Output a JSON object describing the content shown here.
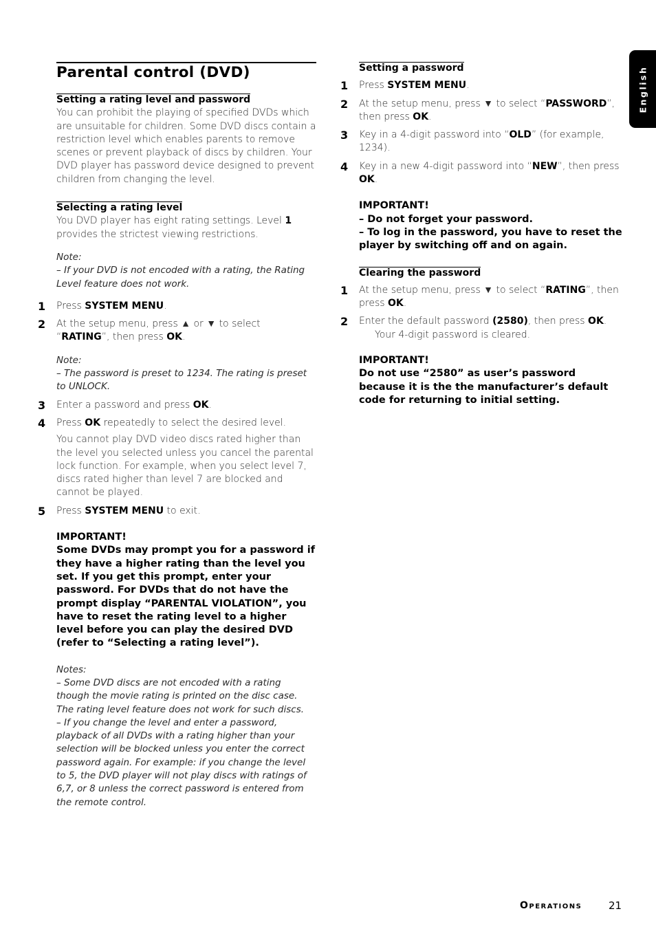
{
  "side_tab": {
    "label": "English"
  },
  "left": {
    "title": "Parental control (DVD)",
    "sec1": {
      "heading": "Setting a rating level and password",
      "body": "You can prohibit the playing of specified DVDs which are unsuitable for children. Some DVD discs contain a restriction level which enables parents to remove scenes or prevent playback of discs by children. Your DVD player has password device designed to prevent children from changing the level."
    },
    "sec2": {
      "heading": "Selecting a rating level",
      "body_pre": "You DVD player has eight rating settings. Level ",
      "body_bold": "1",
      "body_post": " provides the strictest viewing restrictions.",
      "note1_label": "Note:",
      "note1_text": "–  If your DVD is not encoded with a rating, the Rating Level feature does not work.",
      "steps": [
        {
          "num": "1",
          "pre": "Press ",
          "bold": "SYSTEM MENU",
          "post": "."
        },
        {
          "num": "2",
          "pre": "At the setup menu, press ▲ or ▼ to select “",
          "bold": "RATING",
          "post": "”, then press ",
          "bold2": "OK",
          "post2": "."
        }
      ],
      "note2_label": "Note:",
      "note2_text": "–  The password is preset to 1234. The rating is preset to UNLOCK.",
      "steps2": [
        {
          "num": "3",
          "pre": "Enter a password and press ",
          "bold": "OK",
          "post": "."
        },
        {
          "num": "4",
          "pre": "Press ",
          "bold": "OK",
          "post": " repeatedly to select the desired level."
        }
      ],
      "step4_detail": "You cannot play DVD video discs rated higher than the level you selected unless you cancel the parental lock function. For example, when you select level 7, discs rated higher than level 7 are blocked and cannot be played.",
      "step5": {
        "num": "5",
        "pre": "Press ",
        "bold": "SYSTEM MENU",
        "post": " to exit."
      },
      "important_label": "IMPORTANT!",
      "important_text": "Some DVDs may prompt you for a password if they have a higher rating than the level you set. If you get this prompt, enter your password.  For DVDs that do not have the prompt display “PARENTAL VIOLATION”,  you have to reset the rating level to a higher level before you can play the desired DVD (refer to “Selecting a rating level”).",
      "notes_label": "Notes:",
      "notes": [
        "–  Some DVD discs are not encoded with a rating though the movie rating is printed on the disc case. The rating level feature does not work for such discs.",
        "–  If you change the level and enter a password, playback of all DVDs with a rating higher than your selection will be blocked unless you enter the correct password again. For example: if you change the level to 5, the DVD player will not play discs with ratings of 6,7, or 8 unless the correct password is entered from the remote control."
      ]
    }
  },
  "right": {
    "sec3": {
      "heading": "Setting a password",
      "steps": [
        {
          "num": "1",
          "pre": "Press ",
          "bold": "SYSTEM MENU",
          "post": "."
        },
        {
          "num": "2",
          "pre": "At the setup menu, press ▼ to select “",
          "bold": "PASSWORD",
          "post": "”, then press ",
          "bold2": "OK",
          "post2": "."
        },
        {
          "num": "3",
          "pre": "Key in a 4-digit password into “",
          "bold": "OLD",
          "post": "” (for example, 1234)."
        },
        {
          "num": "4",
          "pre": "Key in a new 4-digit password into “",
          "bold": "NEW",
          "post": "”, then press ",
          "bold2": "OK",
          "post2": "."
        }
      ],
      "important_label": "IMPORTANT!",
      "important_items": [
        "–  Do not forget your password.",
        "–  To log in the password, you have to reset the player by switching off and on again."
      ]
    },
    "sec4": {
      "heading": "Clearing the password",
      "steps": [
        {
          "num": "1",
          "pre": "At the setup menu, press ▼ to select “",
          "bold": "RATING",
          "post": "”, then press ",
          "bold2": "OK",
          "post2": "."
        },
        {
          "num": "2",
          "pre": "Enter the default password ",
          "bold": "(2580)",
          "post": ", then press ",
          "bold2": "OK",
          "post2": "."
        }
      ],
      "step2_detail": "Your 4-digit password is cleared.",
      "important_label": "IMPORTANT!",
      "important_text": "Do not use “2580” as user’s password because it is the the manufacturer’s default code for returning to initial setting."
    }
  },
  "footer": {
    "section": "Operations",
    "page_number": "21"
  }
}
